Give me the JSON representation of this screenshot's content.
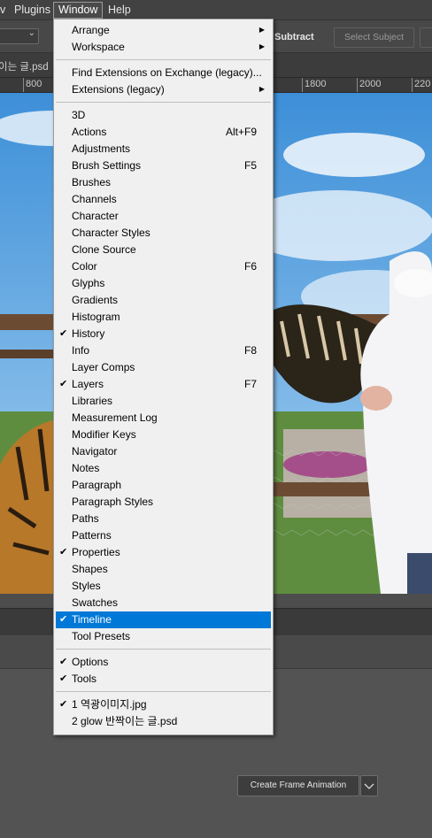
{
  "menubar": {
    "items": [
      {
        "label": "v"
      },
      {
        "label": "Plugins"
      },
      {
        "label": "Window"
      },
      {
        "label": "Help"
      }
    ],
    "active_index": 2
  },
  "options_bar": {
    "subtract_label": "Subtract",
    "select_subject_label": "Select Subject"
  },
  "document": {
    "tab_label": "이는 글.psd"
  },
  "ruler": {
    "labels": [
      "800",
      "1800",
      "2000",
      "220"
    ]
  },
  "timeline": {
    "create_button_label": "Create Frame Animation"
  },
  "window_menu": {
    "groups": [
      [
        {
          "label": "Arrange",
          "submenu": true
        },
        {
          "label": "Workspace",
          "submenu": true
        }
      ],
      [
        {
          "label": "Find Extensions on Exchange (legacy)..."
        },
        {
          "label": "Extensions (legacy)",
          "submenu": true
        }
      ],
      [
        {
          "label": "3D"
        },
        {
          "label": "Actions",
          "shortcut": "Alt+F9"
        },
        {
          "label": "Adjustments"
        },
        {
          "label": "Brush Settings",
          "shortcut": "F5"
        },
        {
          "label": "Brushes"
        },
        {
          "label": "Channels"
        },
        {
          "label": "Character"
        },
        {
          "label": "Character Styles"
        },
        {
          "label": "Clone Source"
        },
        {
          "label": "Color",
          "shortcut": "F6"
        },
        {
          "label": "Glyphs"
        },
        {
          "label": "Gradients"
        },
        {
          "label": "Histogram"
        },
        {
          "label": "History",
          "checked": true
        },
        {
          "label": "Info",
          "shortcut": "F8"
        },
        {
          "label": "Layer Comps"
        },
        {
          "label": "Layers",
          "shortcut": "F7",
          "checked": true
        },
        {
          "label": "Libraries"
        },
        {
          "label": "Measurement Log"
        },
        {
          "label": "Modifier Keys"
        },
        {
          "label": "Navigator"
        },
        {
          "label": "Notes"
        },
        {
          "label": "Paragraph"
        },
        {
          "label": "Paragraph Styles"
        },
        {
          "label": "Paths"
        },
        {
          "label": "Patterns"
        },
        {
          "label": "Properties",
          "checked": true
        },
        {
          "label": "Shapes"
        },
        {
          "label": "Styles"
        },
        {
          "label": "Swatches"
        },
        {
          "label": "Timeline",
          "checked": true,
          "highlighted": true
        },
        {
          "label": "Tool Presets"
        }
      ],
      [
        {
          "label": "Options",
          "checked": true
        },
        {
          "label": "Tools",
          "checked": true
        }
      ],
      [
        {
          "label": "1 역광이미지.jpg",
          "checked": true
        },
        {
          "label": "2 glow 반짝이는 글.psd"
        }
      ]
    ]
  },
  "colors": {
    "highlight": "#0078d7",
    "menu_bg": "#f0f0f0",
    "app_bg": "#535353"
  }
}
